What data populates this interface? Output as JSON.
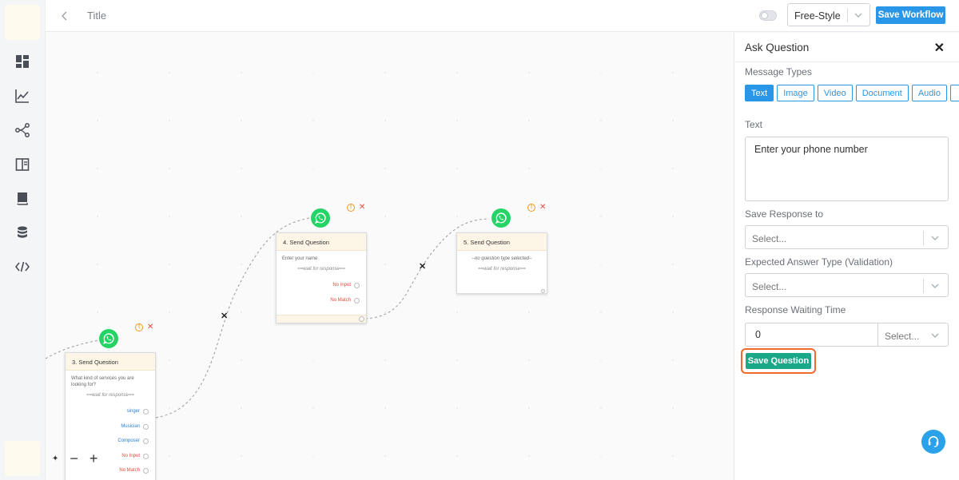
{
  "header": {
    "title": "Title",
    "mode_value": "Free-Style",
    "save_workflow_label": "Save Workflow"
  },
  "sidebar": {
    "items": [
      {
        "icon": "dashboard-icon"
      },
      {
        "icon": "analytics-icon"
      },
      {
        "icon": "workflow-icon"
      },
      {
        "icon": "templates-icon"
      },
      {
        "icon": "book-icon"
      },
      {
        "icon": "database-icon"
      },
      {
        "icon": "code-icon"
      }
    ]
  },
  "canvas": {
    "nodes": [
      {
        "title": "3. Send Question",
        "description": "What kind of services you are looking for?",
        "wait_text": "==wait for response==",
        "options": [
          "singer",
          "Musician",
          "Composer",
          "No Input",
          "No Match"
        ]
      },
      {
        "title": "4. Send Question",
        "description": "Enter your name",
        "wait_text": "==wait for response==",
        "options": [
          "No Input",
          "No Match"
        ]
      },
      {
        "title": "5. Send Question",
        "description": "--no question type selected--",
        "wait_text": "==wait for response=="
      }
    ],
    "info_glyph": "!",
    "delete_glyph": "✕",
    "edge_delete_glyph": "✕",
    "zoom": {
      "wand": "✦",
      "minus": "−",
      "plus": "+"
    }
  },
  "panel": {
    "title": "Ask Question",
    "close_glyph": "✕",
    "message_types_label": "Message Types",
    "message_types": [
      "Text",
      "Image",
      "Video",
      "Document",
      "Audio",
      ""
    ],
    "active_type": "Text",
    "text_label": "Text",
    "text_value": "Enter your phone number",
    "save_response_label": "Save Response to",
    "save_response_placeholder": "Select...",
    "expected_answer_label": "Expected Answer Type (Validation)",
    "expected_answer_placeholder": "Select...",
    "waiting_time_label": "Response Waiting Time",
    "waiting_time_value": "0",
    "waiting_unit_placeholder": "Select...",
    "save_question_label": "Save Question"
  },
  "colors": {
    "primary": "#2a96e8",
    "success": "#1aa78a",
    "highlight": "#f06a2c",
    "danger": "#e04b3a",
    "whatsapp": "#25d366"
  }
}
